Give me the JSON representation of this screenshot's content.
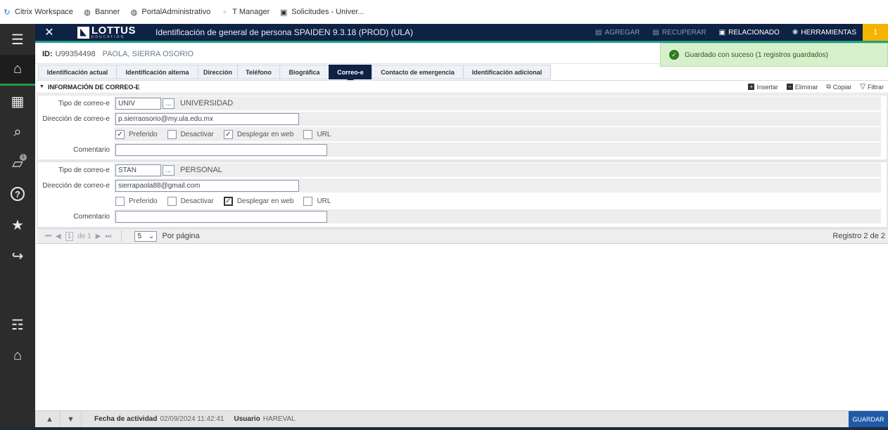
{
  "bookmarks": [
    {
      "label": "Citrix Workspace",
      "icon": "citrix-icon",
      "glyph": "↻",
      "color": "#1a73e8"
    },
    {
      "label": "Banner",
      "icon": "globe-icon",
      "glyph": "◍",
      "color": "#444444"
    },
    {
      "label": "PortalAdministrativo",
      "icon": "globe-icon",
      "glyph": "◍",
      "color": "#444444"
    },
    {
      "label": "T Manager",
      "icon": "star-icon",
      "glyph": "✦",
      "color": "#dddddd"
    },
    {
      "label": "Solicitudes - Univer...",
      "icon": "app-icon",
      "glyph": "▣",
      "color": "#333333"
    }
  ],
  "sidebar": {
    "menu": "☰",
    "home": "⌂",
    "grid": "▦",
    "search": "⌕",
    "folder": "▱",
    "folder_badge": "1",
    "help": "?",
    "favorites": "★",
    "exit": "↪",
    "user": "☶",
    "institution": "⌂"
  },
  "header": {
    "close": "✕",
    "logo_main": "LOTTUS",
    "logo_sub": "EDUCATION",
    "title": "Identificación de general de persona SPAIDEN 9.3.18 (PROD) (ULA)",
    "actions": [
      {
        "label": "AGREGAR",
        "state": "disabled"
      },
      {
        "label": "RECUPERAR",
        "state": "disabled"
      },
      {
        "label": "RELACIONADO",
        "state": "enabled"
      },
      {
        "label": "HERRAMIENTAS",
        "state": "enabled"
      }
    ],
    "notification_count": "1"
  },
  "id_row": {
    "id_label": "ID:",
    "id_value": "U99354498",
    "name": "PAOLA, SIERRA OSORIO"
  },
  "toast": {
    "message": "Guardado con suceso (1 registros guardados)",
    "color": "#d6f0cc"
  },
  "tabs": [
    {
      "label": "Identificación actual",
      "active": false
    },
    {
      "label": "Identificación alterna",
      "active": false
    },
    {
      "label": "Dirección",
      "active": false
    },
    {
      "label": "Teléfono",
      "active": false
    },
    {
      "label": "Biográfica",
      "active": false
    },
    {
      "label": "Correo-e",
      "active": true
    },
    {
      "label": "Contacto de emergencia",
      "active": false
    },
    {
      "label": "Identificación adicional",
      "active": false
    }
  ],
  "section": {
    "title": "INFORMACIÓN DE CORREO-E",
    "tools": {
      "insert": "Insertar",
      "delete": "Eliminar",
      "copy": "Copiar",
      "filter": "Filtrar"
    }
  },
  "labels": {
    "type": "Tipo de correo-e",
    "address": "Dirección de correo-e",
    "comment": "Comentario",
    "preferred": "Preferido",
    "inactivate": "Desactivar",
    "display_web": "Desplegar en web",
    "url": "URL",
    "lookup": "..."
  },
  "records": [
    {
      "type_code": "UNIV",
      "type_desc": "UNIVERSIDAD",
      "address": "p.sierraosorio@my.ula.edu.mx",
      "comment": "",
      "preferred": true,
      "inactivate": false,
      "display_web": true,
      "url": false
    },
    {
      "type_code": "STAN",
      "type_desc": "PERSONAL",
      "address": "sierrapaola88@gmail.com",
      "comment": "",
      "preferred": false,
      "inactivate": false,
      "display_web": true,
      "url": false
    }
  ],
  "pager": {
    "current_page": "1",
    "of_label": "de 1",
    "per_page": "5",
    "per_page_label": "Por página",
    "record_count": "Registro 2 de 2"
  },
  "footer": {
    "activity_label": "Fecha de actividad",
    "activity_date": "02/09/2024 11:42:41",
    "user_label": "Usuario",
    "user": "HAREVAL",
    "save": "GUARDAR"
  },
  "colors": {
    "header_bg": "#0e2244",
    "accent_green": "#1c9f86",
    "notification": "#f4b400",
    "save_button": "#1e5aa8"
  }
}
